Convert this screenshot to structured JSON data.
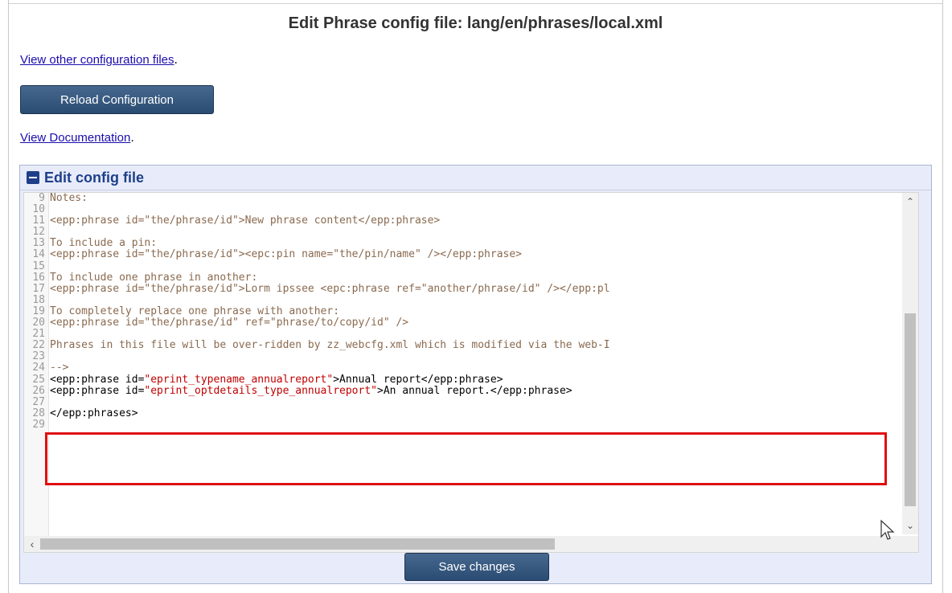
{
  "header": {
    "title": "Edit Phrase config file: lang/en/phrases/local.xml"
  },
  "links": {
    "other_configs": "View other configuration files",
    "documentation": "View Documentation",
    "period": "."
  },
  "buttons": {
    "reload": "Reload Configuration",
    "save": "Save changes"
  },
  "editor_box": {
    "title": "Edit config file"
  },
  "editor": {
    "lines": [
      {
        "n": "9",
        "text": "Notes:"
      },
      {
        "n": "10",
        "text": ""
      },
      {
        "n": "11",
        "text": "<epp:phrase id=\"the/phrase/id\">New phrase content</epp:phrase>"
      },
      {
        "n": "12",
        "text": ""
      },
      {
        "n": "13",
        "text": "To include a pin:"
      },
      {
        "n": "14",
        "text": "<epp:phrase id=\"the/phrase/id\"><epc:pin name=\"the/pin/name\" /></epp:phrase>"
      },
      {
        "n": "15",
        "text": ""
      },
      {
        "n": "16",
        "text": "To include one phrase in another:"
      },
      {
        "n": "17",
        "text": "<epp:phrase id=\"the/phrase/id\">Lorm ipssee <epc:phrase ref=\"another/phrase/id\" /></epp:pl"
      },
      {
        "n": "18",
        "text": ""
      },
      {
        "n": "19",
        "text": "To completely replace one phrase with another:"
      },
      {
        "n": "20",
        "text": "<epp:phrase id=\"the/phrase/id\" ref=\"phrase/to/copy/id\" />"
      },
      {
        "n": "21",
        "text": ""
      },
      {
        "n": "22",
        "text": "Phrases in this file will be over-ridden by zz_webcfg.xml which is modified via the web-I"
      },
      {
        "n": "23",
        "text": ""
      },
      {
        "n": "24",
        "text": "-->"
      },
      {
        "n": "25",
        "pre": "<epp:phrase id=",
        "str": "\"eprint_typename_annualreport\"",
        "post": ">Annual report</epp:phrase>"
      },
      {
        "n": "26",
        "pre": "<epp:phrase id=",
        "str": "\"eprint_optdetails_type_annualreport\"",
        "post": ">An annual report.</epp:phrase>"
      },
      {
        "n": "27",
        "text": ""
      },
      {
        "n": "28",
        "text": "</epp:phrases>"
      },
      {
        "n": "29",
        "text": ""
      }
    ]
  },
  "icons": {
    "collapse": "minus-square-icon",
    "scroll_up": "chevron-up-icon",
    "scroll_down": "chevron-down-icon",
    "scroll_left": "chevron-left-icon",
    "mouse": "mouse-pointer-icon"
  },
  "colors": {
    "button": "#2b4c72",
    "highlight_box": "#e01010",
    "string": "#c00000",
    "box_title": "#1f3f8a"
  }
}
